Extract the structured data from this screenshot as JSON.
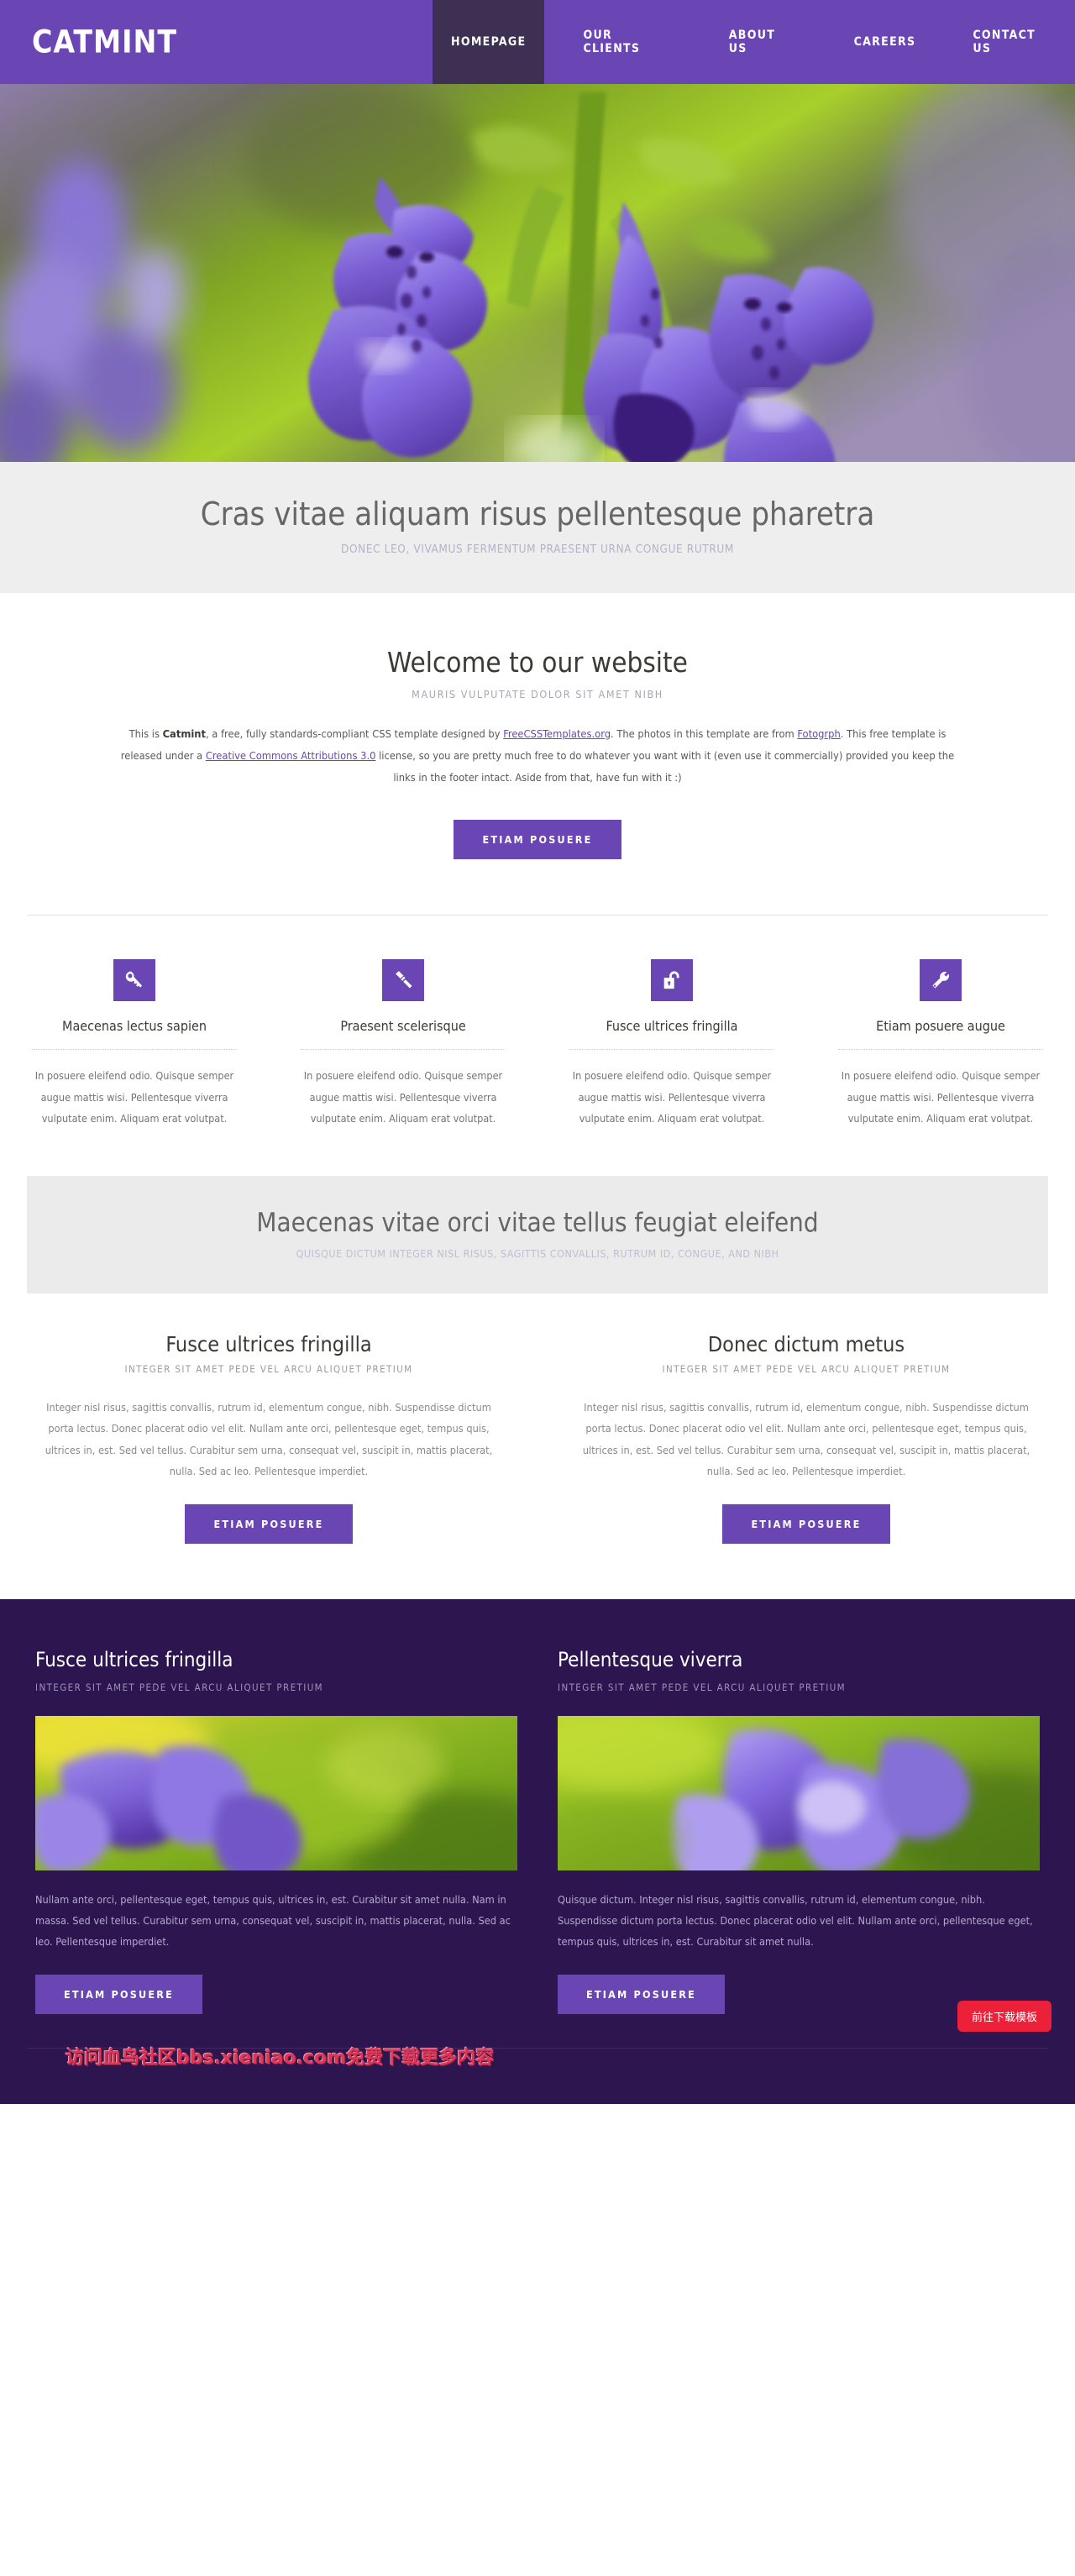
{
  "brand": {
    "logo": "CATMINT",
    "accent": "#6a46b5",
    "dark_accent": "#2d1650",
    "nav_active_bg": "#3e3052"
  },
  "nav": {
    "items": [
      {
        "label": "HOMEPAGE",
        "active": true
      },
      {
        "label": "OUR CLIENTS",
        "active": false
      },
      {
        "label": "ABOUT US",
        "active": false
      },
      {
        "label": "CAREERS",
        "active": false
      },
      {
        "label": "CONTACT US",
        "active": false
      }
    ]
  },
  "hero": {
    "image_alt": "catmint-flowers-photo",
    "title": "Cras vitae aliquam risus pellentesque pharetra",
    "subtitle": "DONEC LEO, VIVAMUS FERMENTUM PRAESENT URNA CONGUE RUTRUM"
  },
  "welcome": {
    "title": "Welcome to our website",
    "subtitle": "MAURIS VULPUTATE DOLOR SIT AMET NIBH",
    "body_prefix": "This is ",
    "body_brand": "Catmint",
    "body_part1": ", a free, fully standards-compliant CSS template designed by ",
    "link1": "FreeCSSTemplates.org",
    "body_part2": ". The photos in this template are from ",
    "link2": "Fotogrph",
    "body_part3": ". This free template is released under a ",
    "link3": "Creative Commons Attributions 3.0",
    "body_part4": " license, so you are pretty much free to do whatever you want with it (even use it commercially) provided you keep the links in the footer intact. Aside from that, have fun with it :)",
    "button": "ETIAM POSUERE"
  },
  "features": [
    {
      "icon": "key-icon",
      "title": "Maecenas lectus sapien",
      "text": "In posuere eleifend odio. Quisque semper augue mattis wisi. Pellentesque viverra vulputate enim. Aliquam erat volutpat."
    },
    {
      "icon": "gavel-icon",
      "title": "Praesent scelerisque",
      "text": "In posuere eleifend odio. Quisque semper augue mattis wisi. Pellentesque viverra vulputate enim. Aliquam erat volutpat."
    },
    {
      "icon": "unlock-icon",
      "title": "Fusce ultrices fringilla",
      "text": "In posuere eleifend odio. Quisque semper augue mattis wisi. Pellentesque viverra vulputate enim. Aliquam erat volutpat."
    },
    {
      "icon": "wrench-icon",
      "title": "Etiam posuere augue",
      "text": "In posuere eleifend odio. Quisque semper augue mattis wisi. Pellentesque viverra vulputate enim. Aliquam erat volutpat."
    }
  ],
  "banner": {
    "title": "Maecenas vitae orci vitae tellus feugiat eleifend",
    "subtitle": "QUISQUE DICTUM INTEGER NISL RISUS, SAGITTIS CONVALLIS, RUTRUM ID, CONGUE, AND NIBH"
  },
  "two_col": [
    {
      "title": "Fusce ultrices fringilla",
      "subtitle": "INTEGER SIT AMET PEDE VEL ARCU ALIQUET PRETIUM",
      "text": "Integer nisl risus, sagittis convallis, rutrum id, elementum congue, nibh. Suspendisse dictum porta lectus. Donec placerat odio vel elit. Nullam ante orci, pellentesque eget, tempus quis, ultrices in, est. Sed vel tellus. Curabitur sem urna, consequat vel, suscipit in, mattis placerat, nulla. Sed ac leo. Pellentesque imperdiet.",
      "button": "ETIAM POSUERE"
    },
    {
      "title": "Donec dictum metus",
      "subtitle": "INTEGER SIT AMET PEDE VEL ARCU ALIQUET PRETIUM",
      "text": "Integer nisl risus, sagittis convallis, rutrum id, elementum congue, nibh. Suspendisse dictum porta lectus. Donec placerat odio vel elit. Nullam ante orci, pellentesque eget, tempus quis, ultrices in, est. Sed vel tellus. Curabitur sem urna, consequat vel, suscipit in, mattis placerat, nulla. Sed ac leo. Pellentesque imperdiet.",
      "button": "ETIAM POSUERE"
    }
  ],
  "dark_cols": [
    {
      "title": "Fusce ultrices fringilla",
      "subtitle": "INTEGER SIT AMET PEDE VEL ARCU ALIQUET PRETIUM",
      "image_alt": "catmint-thumbnail-one",
      "text": "Nullam ante orci, pellentesque eget, tempus quis, ultrices in, est. Curabitur sit amet nulla. Nam in massa. Sed vel tellus. Curabitur sem urna, consequat vel, suscipit in, mattis placerat, nulla. Sed ac leo. Pellentesque imperdiet.",
      "button": "ETIAM POSUERE"
    },
    {
      "title": "Pellentesque viverra",
      "subtitle": "INTEGER SIT AMET PEDE VEL ARCU ALIQUET PRETIUM",
      "image_alt": "catmint-thumbnail-two",
      "text": "Quisque dictum. Integer nisl risus, sagittis convallis, rutrum id, elementum congue, nibh. Suspendisse dictum porta lectus. Donec placerat odio vel elit. Nullam ante orci, pellentesque eget, tempus quis, ultrices in, est. Curabitur sit amet nulla.",
      "button": "ETIAM POSUERE"
    }
  ],
  "footer": {
    "watermark": "访问血鸟社区bbs.xieniao.com免费下载更多内容",
    "download_button": "前往下载模板"
  }
}
